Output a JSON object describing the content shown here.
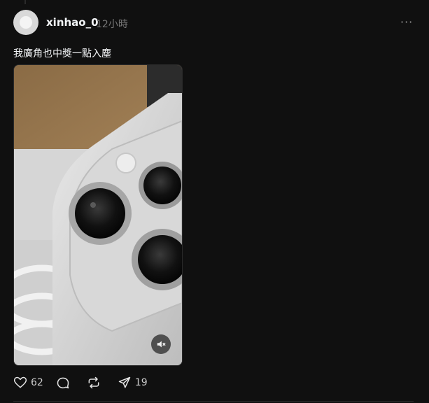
{
  "post": {
    "username": "xinhao_0",
    "timestamp": "12小時",
    "more_label": "···",
    "text": "我廣角也中獎一點入塵"
  },
  "actions": {
    "like_count": "62",
    "share_count": "19"
  },
  "icons": {
    "like": "heart-icon",
    "reply": "comment-icon",
    "repost": "repost-icon",
    "share": "send-icon",
    "mute": "speaker-muted-icon"
  },
  "colors": {
    "background": "#101010",
    "text_primary": "#f3f5f7",
    "text_secondary": "#777777"
  }
}
